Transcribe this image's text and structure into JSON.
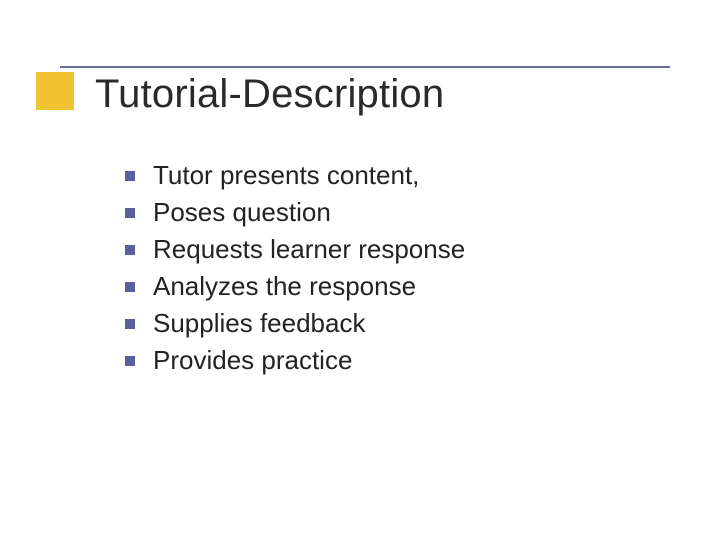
{
  "slide": {
    "title": "Tutorial-Description",
    "bullets": [
      "Tutor presents content,",
      "Poses question",
      "Requests learner response",
      "Analyzes the response",
      "Supplies feedback",
      "Provides practice"
    ]
  },
  "colors": {
    "accent_square": "#f1c232",
    "rule": "#6a6da0",
    "bullet": "#5a5f9e"
  }
}
